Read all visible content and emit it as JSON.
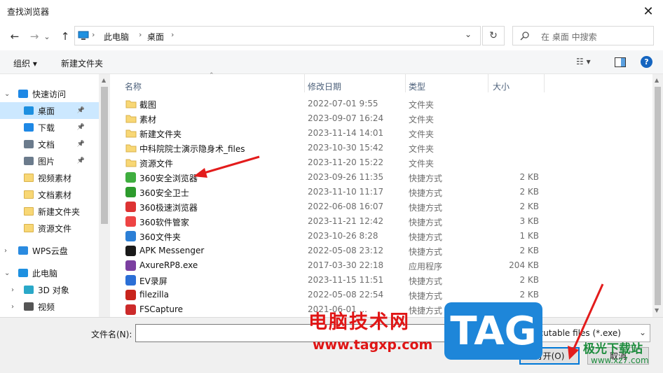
{
  "window": {
    "title": "查找浏览器",
    "close_glyph": "✕"
  },
  "nav": {
    "back_glyph": "←",
    "forward_glyph": "→",
    "recent_glyph": "⌄",
    "up_glyph": "↑",
    "breadcrumb": [
      "此电脑",
      "桌面"
    ],
    "refresh_glyph": "↻",
    "search_placeholder": "在 桌面 中搜索"
  },
  "toolbar": {
    "organize": "组织 ▾",
    "new_folder": "新建文件夹",
    "view_glyph": "☷ ▾",
    "help": "?"
  },
  "sidebar": {
    "items": [
      {
        "label": "快速访问",
        "icon": "star-icon",
        "level": 0,
        "expanded": true
      },
      {
        "label": "桌面",
        "icon": "desktop-icon",
        "level": 1,
        "selected": true,
        "pinned": true
      },
      {
        "label": "下载",
        "icon": "download-icon",
        "level": 1,
        "pinned": true
      },
      {
        "label": "文档",
        "icon": "document-icon",
        "level": 1,
        "pinned": true
      },
      {
        "label": "图片",
        "icon": "picture-icon",
        "level": 1,
        "pinned": true
      },
      {
        "label": "视频素材",
        "icon": "folder-icon",
        "level": 1
      },
      {
        "label": "文档素材",
        "icon": "folder-icon",
        "level": 1
      },
      {
        "label": "新建文件夹",
        "icon": "folder-icon",
        "level": 1
      },
      {
        "label": "资源文件",
        "icon": "folder-icon",
        "level": 1
      },
      {
        "label": "WPS云盘",
        "icon": "cloud-icon",
        "level": 0
      },
      {
        "label": "此电脑",
        "icon": "computer-icon",
        "level": 0,
        "expanded": true
      },
      {
        "label": "3D 对象",
        "icon": "3d-objects-icon",
        "level": 1
      },
      {
        "label": "视频",
        "icon": "video-icon",
        "level": 1
      }
    ]
  },
  "columns": {
    "name": "名称",
    "date": "修改日期",
    "type": "类型",
    "size": "大小"
  },
  "files": [
    {
      "name": "截图",
      "date": "2022-07-01 9:55",
      "type": "文件夹",
      "size": "",
      "icon": "folder-icon"
    },
    {
      "name": "素材",
      "date": "2023-09-07 16:24",
      "type": "文件夹",
      "size": "",
      "icon": "folder-icon"
    },
    {
      "name": "新建文件夹",
      "date": "2023-11-14 14:01",
      "type": "文件夹",
      "size": "",
      "icon": "folder-icon"
    },
    {
      "name": "中科院院士演示隐身术_files",
      "date": "2023-10-30 15:42",
      "type": "文件夹",
      "size": "",
      "icon": "folder-icon"
    },
    {
      "name": "资源文件",
      "date": "2023-11-20 15:22",
      "type": "文件夹",
      "size": "",
      "icon": "folder-icon"
    },
    {
      "name": "360安全浏览器",
      "date": "2023-09-26 11:35",
      "type": "快捷方式",
      "size": "2 KB",
      "icon": "360-browser-icon"
    },
    {
      "name": "360安全卫士",
      "date": "2023-11-10 11:17",
      "type": "快捷方式",
      "size": "2 KB",
      "icon": "360-guard-icon"
    },
    {
      "name": "360极速浏览器",
      "date": "2022-06-08 16:07",
      "type": "快捷方式",
      "size": "2 KB",
      "icon": "360-speed-browser-icon"
    },
    {
      "name": "360软件管家",
      "date": "2023-11-21 12:42",
      "type": "快捷方式",
      "size": "3 KB",
      "icon": "360-software-manager-icon"
    },
    {
      "name": "360文件夹",
      "date": "2023-10-26 8:28",
      "type": "快捷方式",
      "size": "1 KB",
      "icon": "360-folder-icon"
    },
    {
      "name": "APK Messenger",
      "date": "2022-05-08 23:12",
      "type": "快捷方式",
      "size": "2 KB",
      "icon": "apk-messenger-icon"
    },
    {
      "name": "AxureRP8.exe",
      "date": "2017-03-30 22:18",
      "type": "应用程序",
      "size": "204 KB",
      "icon": "axure-icon"
    },
    {
      "name": "EV录屏",
      "date": "2023-11-15 11:51",
      "type": "快捷方式",
      "size": "2 KB",
      "icon": "ev-recorder-icon"
    },
    {
      "name": "filezilla",
      "date": "2022-05-08 22:54",
      "type": "快捷方式",
      "size": "2 KB",
      "icon": "filezilla-icon"
    },
    {
      "name": "FSCapture",
      "date": "2021-06-01 ...",
      "type": "快捷方式",
      "size": "2 KB",
      "icon": "fscapture-icon"
    }
  ],
  "bottom": {
    "filename_label": "文件名(N):",
    "filename_value": "",
    "filter": "Executable files (*.exe)",
    "open": "打开(O)",
    "cancel": "取消"
  },
  "watermark": {
    "site_cn": "电脑技术网",
    "site_url": "www.tagxp.com",
    "tag": "TAG",
    "xz": "极光下载站",
    "xz_url": "www.xz7.com"
  },
  "colors": {
    "selection": "#cce8ff",
    "accent": "#0078d7",
    "annotation_arrow": "#e31c1c"
  }
}
